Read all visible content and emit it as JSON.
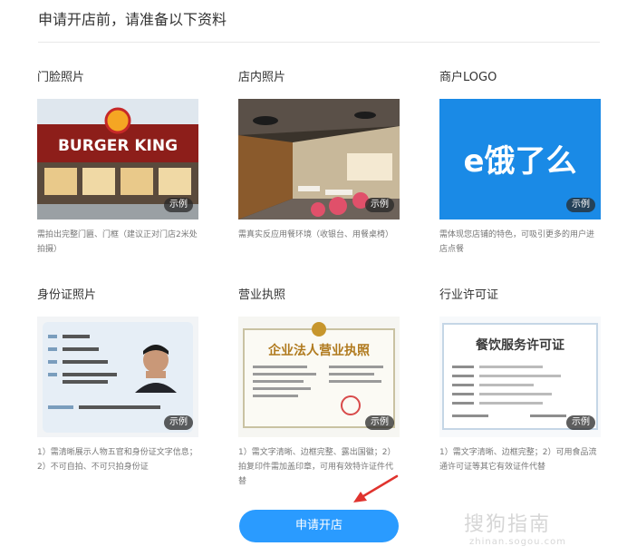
{
  "header": {
    "title": "申请开店前，请准备以下资料"
  },
  "cards": [
    {
      "title": "门脸照片",
      "badge": "示例",
      "desc": "需拍出完整门匾、门框（建议正对门店2米处拍摄）",
      "sign": "BURGER KING"
    },
    {
      "title": "店内照片",
      "badge": "示例",
      "desc": "需真实反应用餐环境（收银台、用餐桌椅）"
    },
    {
      "title": "商户LOGO",
      "badge": "示例",
      "desc": "需体现您店铺的特色，可吸引更多的用户进店点餐",
      "logo_text": "e饿了么"
    },
    {
      "title": "身份证照片",
      "badge": "示例",
      "desc": "1）需清晰展示人物五官和身份证文字信息；2）不可自拍、不可只拍身份证"
    },
    {
      "title": "营业执照",
      "badge": "示例",
      "desc": "1）需文字清晰、边框完整、露出国徽；2）拍复印件需加盖印章，可用有效特许证件代替",
      "doc_title": "企业法人营业执照"
    },
    {
      "title": "行业许可证",
      "badge": "示例",
      "desc": "1）需文字清晰、边框完整；2）可用食品流通许可证等其它有效证件代替",
      "doc_title": "餐饮服务许可证"
    }
  ],
  "submit": {
    "label": "申请开店"
  },
  "watermark": {
    "main": "搜狗指南",
    "sub": "zhinan.sogou.com"
  },
  "colors": {
    "accent": "#2a9bff",
    "logo_bg": "#1a8ae6"
  }
}
